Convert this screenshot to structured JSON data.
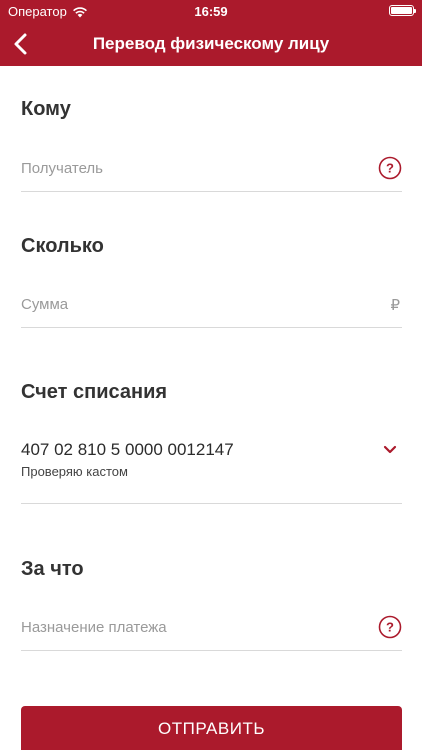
{
  "status_bar": {
    "carrier": "Оператор",
    "time": "16:59",
    "battery_level": 1.0
  },
  "nav": {
    "title": "Перевод физическому лицу",
    "back_icon": "chevron-left-icon"
  },
  "recipient": {
    "title": "Кому",
    "placeholder": "Получатель",
    "icon": "question-circle-icon"
  },
  "amount": {
    "title": "Сколько",
    "placeholder": "Сумма",
    "currency": "₽"
  },
  "account": {
    "title": "Счет списания",
    "number": "407 02 810 5 0000 0012147",
    "name": "Проверяю кастом",
    "icon": "chevron-down-icon"
  },
  "purpose": {
    "title": "За что",
    "placeholder": "Назначение платежа",
    "icon": "question-circle-icon"
  },
  "submit": {
    "label": "ОТПРАВИТЬ"
  },
  "colors": {
    "accent": "#ab1a2c",
    "divider": "#d9d9d9",
    "placeholder": "#9a9a9a"
  }
}
